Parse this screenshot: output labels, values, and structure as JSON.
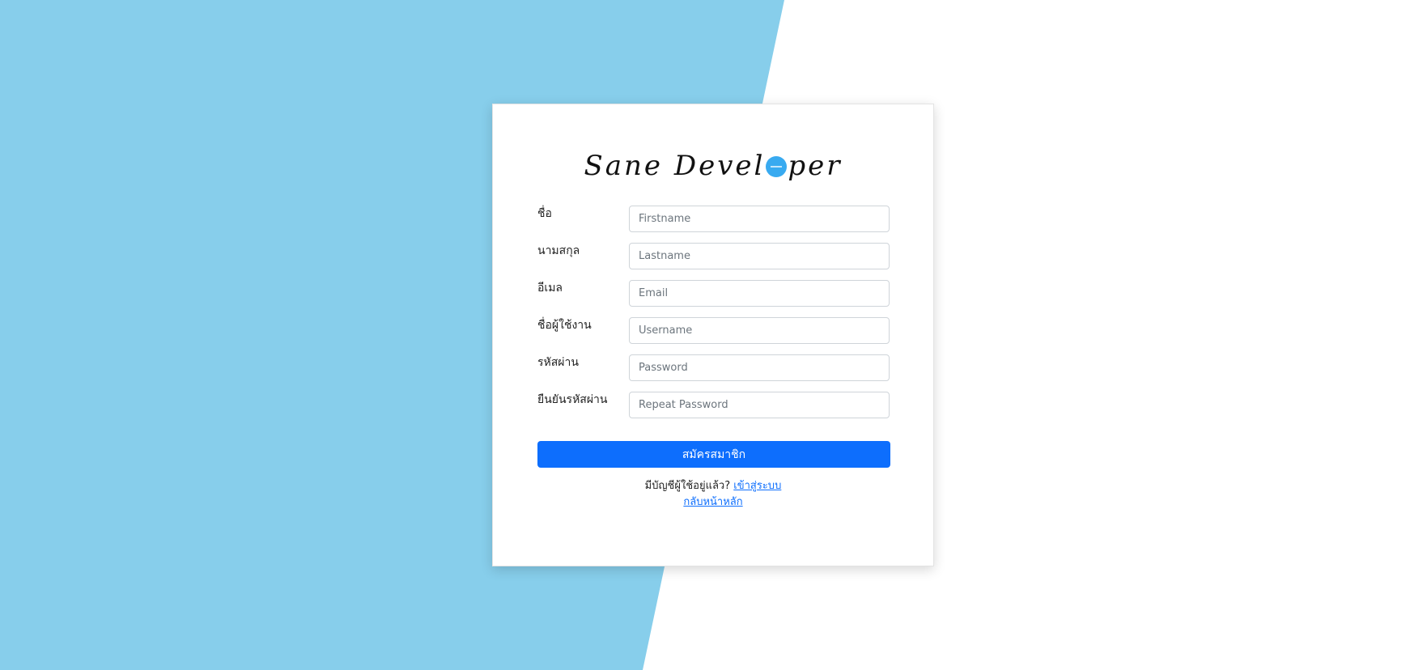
{
  "logo": {
    "text_before": "Sane Devel",
    "text_after": "per"
  },
  "form": {
    "fields": [
      {
        "label": "ชื่อ",
        "placeholder": "Firstname"
      },
      {
        "label": "นามสกุล",
        "placeholder": "Lastname"
      },
      {
        "label": "อีเมล",
        "placeholder": "Email"
      },
      {
        "label": "ชื่อผู้ใช้งาน",
        "placeholder": "Username"
      },
      {
        "label": "รหัสผ่าน",
        "placeholder": "Password"
      },
      {
        "label": "ยืนยันรหัสผ่าน",
        "placeholder": "Repeat Password"
      }
    ],
    "submit_label": "สมัครสมาชิก"
  },
  "footer": {
    "have_account_text": "มีบัญชีผู้ใช้อยู่แล้ว?",
    "login_link": "เข้าสู่ระบบ",
    "home_link": "กลับหน้าหลัก"
  },
  "colors": {
    "background_accent": "#87ceeb",
    "primary": "#0d6efd",
    "logo_dot": "#38aaf0"
  }
}
